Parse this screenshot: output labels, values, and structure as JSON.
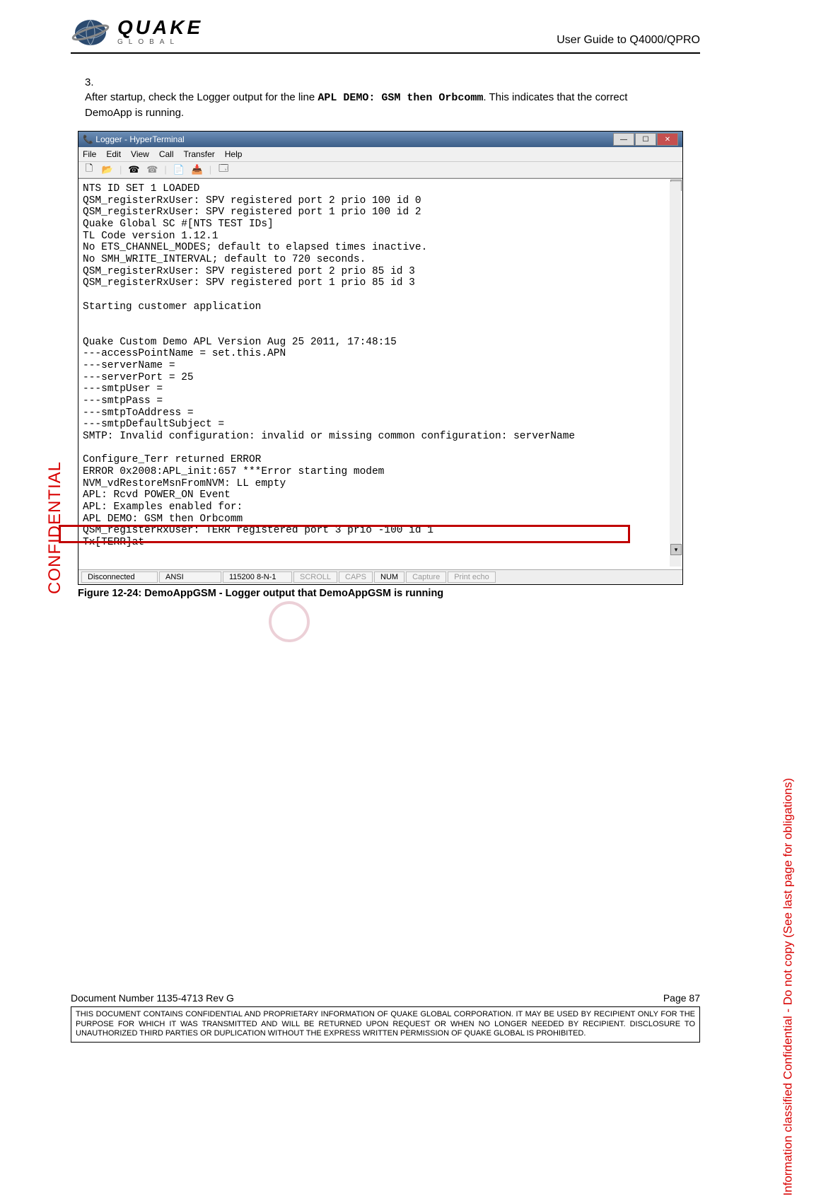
{
  "header": {
    "logo_main": "QUAKE",
    "logo_sub": "GLOBAL",
    "doc_title": "User Guide to Q4000/QPRO"
  },
  "step": {
    "num": "3.",
    "text_a": "After startup, check the Logger output for the line ",
    "code": "APL DEMO: GSM then Orbcomm",
    "text_b": ".  This indicates that the correct DemoApp is running."
  },
  "window": {
    "title": "Logger - HyperTerminal",
    "menus": [
      "File",
      "Edit",
      "View",
      "Call",
      "Transfer",
      "Help"
    ],
    "terminal_text": "NTS ID SET 1 LOADED\nQSM_registerRxUser: SPV registered port 2 prio 100 id 0\nQSM_registerRxUser: SPV registered port 1 prio 100 id 2\nQuake Global SC #[NTS TEST IDs]\nTL Code version 1.12.1\nNo ETS_CHANNEL_MODES; default to elapsed times inactive.\nNo SMH_WRITE_INTERVAL; default to 720 seconds.\nQSM_registerRxUser: SPV registered port 2 prio 85 id 3\nQSM_registerRxUser: SPV registered port 1 prio 85 id 3\n\nStarting customer application\n\n\nQuake Custom Demo APL Version Aug 25 2011, 17:48:15\n---accessPointName = set.this.APN\n---serverName =\n---serverPort = 25\n---smtpUser =\n---smtpPass =\n---smtpToAddress =\n---smtpDefaultSubject =\nSMTP: Invalid configuration: invalid or missing common configuration: serverName\n\nConfigure_Terr returned ERROR\nERROR 0x2008:APL_init:657 ***Error starting modem\nNVM_vdRestoreMsnFromNVM: LL empty\nAPL: Rcvd POWER_ON Event\nAPL: Examples enabled for:\nAPL DEMO: GSM then Orbcomm\nQSM_registerRxUser: TERR registered port 3 prio -100 id 1\nTx[TERR]at",
    "status": {
      "conn": "Disconnected",
      "mode": "ANSI",
      "baud": "115200 8-N-1",
      "scroll": "SCROLL",
      "caps": "CAPS",
      "num": "NUM",
      "capture": "Capture",
      "print": "Print echo"
    }
  },
  "caption": "Figure 12-24:  DemoAppGSM -  Logger output that DemoAppGSM is running",
  "watermarks": {
    "left": "CONFIDENTIAL",
    "right": "Information classified Confidential - Do not copy (See last page for obligations)"
  },
  "footer": {
    "docnum": "Document Number 1135-4713   Rev G",
    "page": "Page 87",
    "notice": "THIS DOCUMENT CONTAINS CONFIDENTIAL AND PROPRIETARY INFORMATION OF QUAKE GLOBAL CORPORATION.  IT MAY BE USED BY RECIPIENT ONLY FOR THE PURPOSE FOR WHICH IT WAS TRANSMITTED AND WILL BE RETURNED UPON REQUEST OR WHEN NO LONGER NEEDED BY RECIPIENT.  DISCLOSURE TO UNAUTHORIZED THIRD PARTIES OR DUPLICATION WITHOUT THE EXPRESS WRITTEN PERMISSION OF QUAKE GLOBAL IS PROHIBITED."
  }
}
